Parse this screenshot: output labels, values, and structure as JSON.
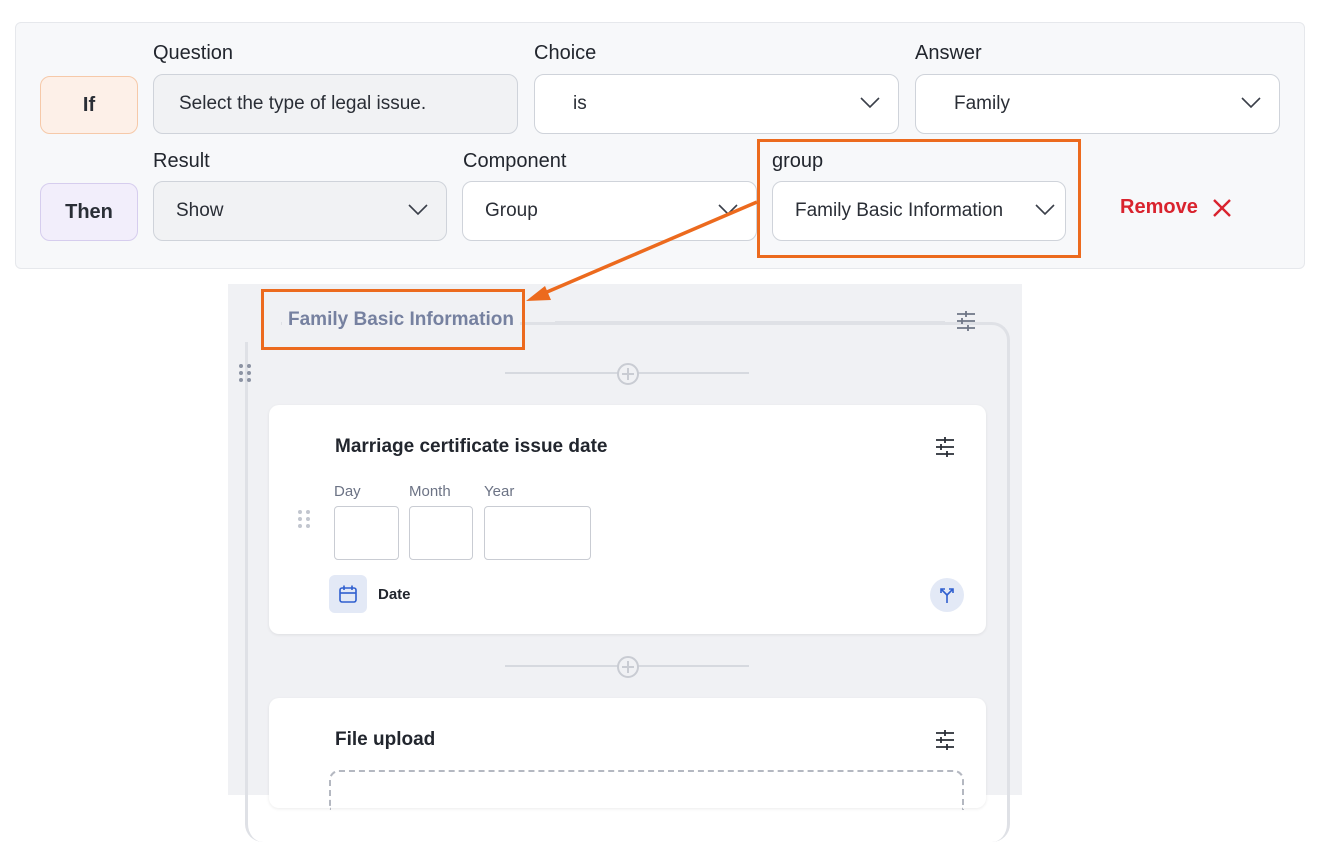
{
  "rule": {
    "if_label": "If",
    "then_label": "Then",
    "question_label": "Question",
    "question_value": "Select the type of legal issue.",
    "choice_label": "Choice",
    "choice_value": "is",
    "answer_label": "Answer",
    "answer_value": "Family",
    "result_label": "Result",
    "result_value": "Show",
    "component_label": "Component",
    "component_value": "Group",
    "group_label": "group",
    "group_value": "Family Basic Information",
    "remove_label": "Remove"
  },
  "form": {
    "group_title": "Family Basic Information",
    "date_card": {
      "title": "Marriage certificate issue date",
      "day_label": "Day",
      "month_label": "Month",
      "year_label": "Year",
      "type_label": "Date"
    },
    "upload_card": {
      "title": "File upload"
    }
  },
  "colors": {
    "highlight": "#ec6a1e",
    "remove": "#d9232e",
    "group_title": "#7681a0"
  }
}
